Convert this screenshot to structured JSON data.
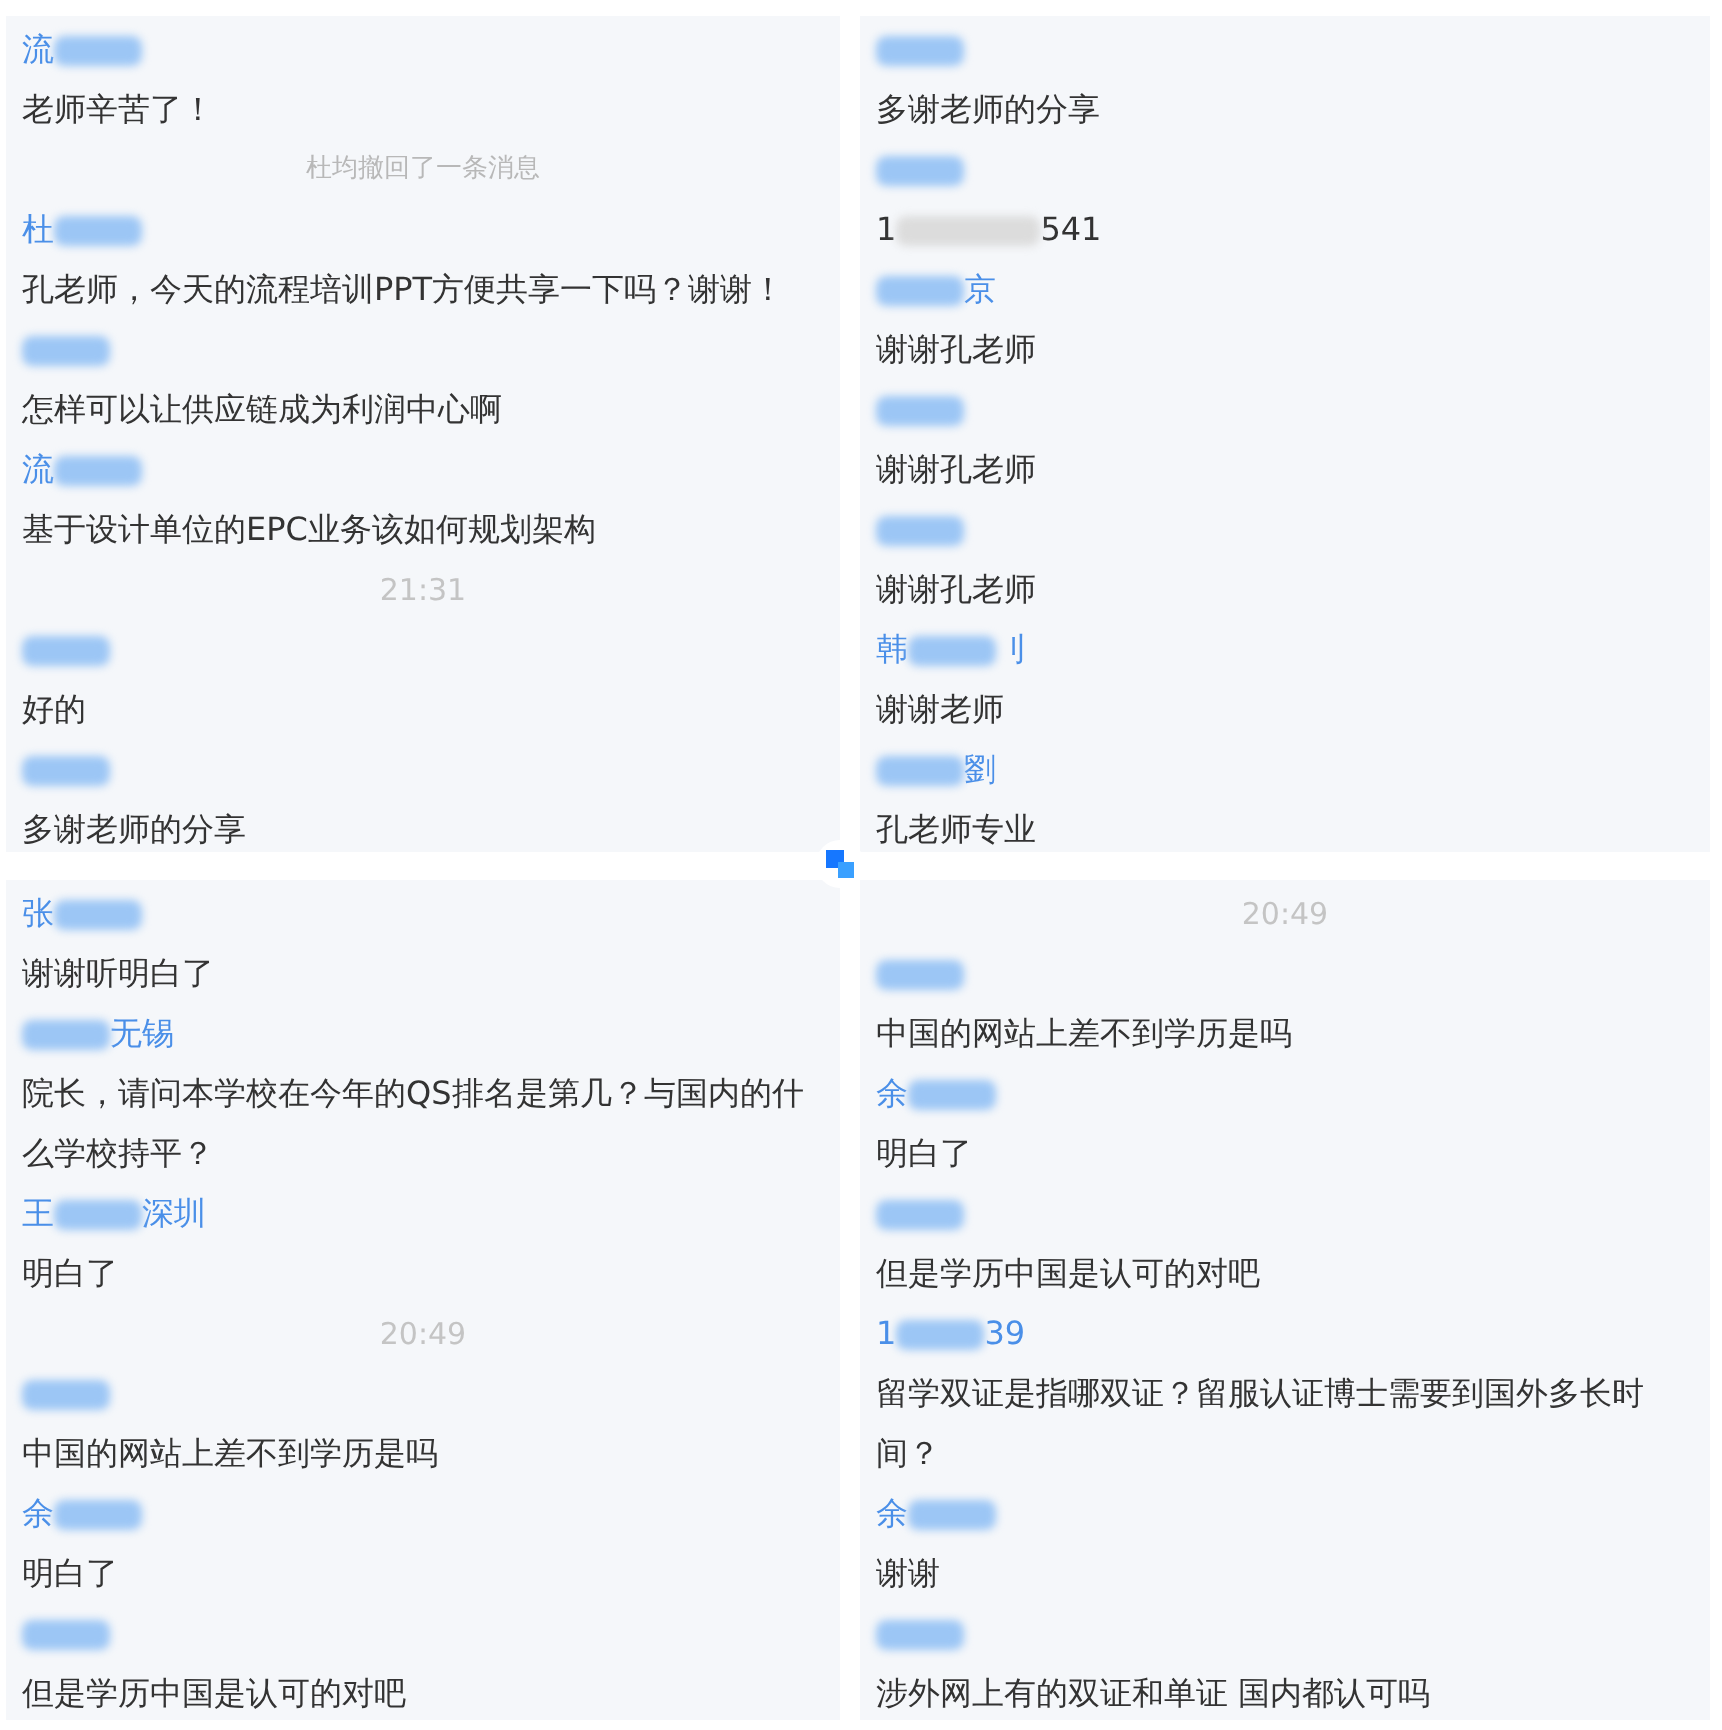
{
  "panels": [
    {
      "items": [
        {
          "kind": "sender",
          "prefix": "流"
        },
        {
          "kind": "message",
          "text": "老师辛苦了！"
        },
        {
          "kind": "notice",
          "text": "杜均撤回了一条消息"
        },
        {
          "kind": "sender",
          "prefix": "杜"
        },
        {
          "kind": "message",
          "text": "孔老师，今天的流程培训PPT方便共享一下吗？谢谢！"
        },
        {
          "kind": "sender"
        },
        {
          "kind": "message",
          "text": "怎样可以让供应链成为利润中心啊"
        },
        {
          "kind": "sender",
          "prefix": "流"
        },
        {
          "kind": "message",
          "text": "基于设计单位的EPC业务该如何规划架构"
        },
        {
          "kind": "time",
          "text": "21:31"
        },
        {
          "kind": "sender"
        },
        {
          "kind": "message",
          "text": "好的"
        },
        {
          "kind": "sender"
        },
        {
          "kind": "message",
          "text": "多谢老师的分享"
        }
      ]
    },
    {
      "items": [
        {
          "kind": "sender"
        },
        {
          "kind": "message",
          "text": "多谢老师的分享"
        },
        {
          "kind": "sender"
        },
        {
          "kind": "redacted",
          "prefix": "1",
          "suffix": "541"
        },
        {
          "kind": "sender",
          "suffix": "京"
        },
        {
          "kind": "message",
          "text": "谢谢孔老师"
        },
        {
          "kind": "sender"
        },
        {
          "kind": "message",
          "text": "谢谢孔老师"
        },
        {
          "kind": "sender"
        },
        {
          "kind": "message",
          "text": "谢谢孔老师"
        },
        {
          "kind": "sender",
          "prefix": "韩",
          "suffix": "刂"
        },
        {
          "kind": "message",
          "text": "谢谢老师"
        },
        {
          "kind": "sender",
          "suffix": "劉"
        },
        {
          "kind": "message",
          "text": "孔老师专业"
        }
      ]
    },
    {
      "items": [
        {
          "kind": "sender",
          "prefix": "张"
        },
        {
          "kind": "message",
          "text": "谢谢听明白了"
        },
        {
          "kind": "sender",
          "suffix": "无锡"
        },
        {
          "kind": "message",
          "text": "院长，请问本学校在今年的QS排名是第几？与国内的什么学校持平？"
        },
        {
          "kind": "sender",
          "prefix": "王",
          "suffix": "深圳"
        },
        {
          "kind": "message",
          "text": "明白了"
        },
        {
          "kind": "time",
          "text": "20:49"
        },
        {
          "kind": "sender"
        },
        {
          "kind": "message",
          "text": "中国的网站上差不到学历是吗"
        },
        {
          "kind": "sender",
          "prefix": "余"
        },
        {
          "kind": "message",
          "text": "明白了"
        },
        {
          "kind": "sender"
        },
        {
          "kind": "message",
          "text": "但是学历中国是认可的对吧"
        }
      ]
    },
    {
      "items": [
        {
          "kind": "time",
          "text": "20:49"
        },
        {
          "kind": "sender"
        },
        {
          "kind": "message",
          "text": "中国的网站上差不到学历是吗"
        },
        {
          "kind": "sender",
          "prefix": "余"
        },
        {
          "kind": "message",
          "text": "明白了"
        },
        {
          "kind": "sender"
        },
        {
          "kind": "message",
          "text": "但是学历中国是认可的对吧"
        },
        {
          "kind": "sender",
          "prefix": "1",
          "suffix": "39"
        },
        {
          "kind": "message",
          "text": "留学双证是指哪双证？留服认证博士需要到国外多长时间？"
        },
        {
          "kind": "sender",
          "prefix": "余"
        },
        {
          "kind": "message",
          "text": "谢谢"
        },
        {
          "kind": "sender"
        },
        {
          "kind": "message",
          "text": "涉外网上有的双证和单证 国内都认可吗"
        }
      ]
    }
  ]
}
